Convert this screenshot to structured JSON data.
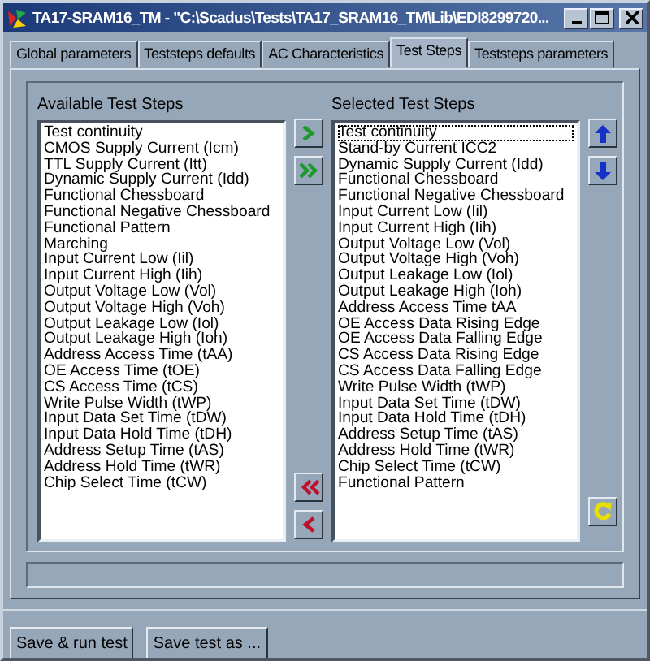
{
  "window": {
    "title": "TA17-SRAM16_TM - \"C:\\Scadus\\Tests\\TA17_SRAM16_TM\\Lib\\EDI8299720..."
  },
  "tabs": [
    {
      "label": "Global parameters",
      "selected": false
    },
    {
      "label": "Teststeps defaults",
      "selected": false
    },
    {
      "label": "AC Characteristics",
      "selected": false
    },
    {
      "label": "Test Steps",
      "selected": true
    },
    {
      "label": "Teststeps parameters",
      "selected": false
    }
  ],
  "available": {
    "label": "Available Test Steps",
    "items": [
      {
        "text": "Test continuity",
        "selected": false
      },
      {
        "text": "CMOS Supply Current (Icm)",
        "selected": false
      },
      {
        "text": "TTL Supply Current (Itt)",
        "selected": false
      },
      {
        "text": "Dynamic Supply Current (Idd)",
        "selected": false
      },
      {
        "text": "Functional Chessboard",
        "selected": false
      },
      {
        "text": "Functional Negative Chessboard",
        "selected": false
      },
      {
        "text": "Functional Pattern",
        "selected": false
      },
      {
        "text": "Marching",
        "selected": false
      },
      {
        "text": "Input Current Low (Iil)",
        "selected": false
      },
      {
        "text": "Input Current High (Iih)",
        "selected": false
      },
      {
        "text": "Output Voltage Low (Vol)",
        "selected": false
      },
      {
        "text": "Output Voltage High (Voh)",
        "selected": false
      },
      {
        "text": "Output Leakage Low (Iol)",
        "selected": false
      },
      {
        "text": "Output Leakage High (Ioh)",
        "selected": false
      },
      {
        "text": "Address Access Time (tAA)",
        "selected": false
      },
      {
        "text": "OE Access Time (tOE)",
        "selected": false
      },
      {
        "text": "CS Access Time (tCS)",
        "selected": false
      },
      {
        "text": "Write Pulse Width (tWP)",
        "selected": false
      },
      {
        "text": "Input Data Set Time (tDW)",
        "selected": false
      },
      {
        "text": "Input Data Hold Time (tDH)",
        "selected": false
      },
      {
        "text": "Address Setup Time (tAS)",
        "selected": false
      },
      {
        "text": "Address Hold Time (tWR)",
        "selected": false
      },
      {
        "text": "Chip Select Time (tCW)",
        "selected": false
      }
    ]
  },
  "selected_steps": {
    "label": "Selected Test Steps",
    "items": [
      {
        "text": "Test continuity",
        "selected": true
      },
      {
        "text": "Stand-by Current ICC2",
        "selected": false
      },
      {
        "text": "Dynamic Supply Current (Idd)",
        "selected": false
      },
      {
        "text": "Functional Chessboard",
        "selected": false
      },
      {
        "text": "Functional Negative Chessboard",
        "selected": false
      },
      {
        "text": "Input Current Low (Iil)",
        "selected": false
      },
      {
        "text": "Input Current High (Iih)",
        "selected": false
      },
      {
        "text": "Output Voltage Low (Vol)",
        "selected": false
      },
      {
        "text": "Output Voltage High (Voh)",
        "selected": false
      },
      {
        "text": "Output Leakage Low (Iol)",
        "selected": false
      },
      {
        "text": "Output Leakage High (Ioh)",
        "selected": false
      },
      {
        "text": "Address Access Time tAA",
        "selected": false
      },
      {
        "text": "OE Access Data Rising Edge",
        "selected": false
      },
      {
        "text": "OE Access Data Falling Edge",
        "selected": false
      },
      {
        "text": "CS Access Data Rising Edge",
        "selected": false
      },
      {
        "text": "CS Access Data Falling Edge",
        "selected": false
      },
      {
        "text": "Write Pulse Width (tWP)",
        "selected": false
      },
      {
        "text": "Input Data Set Time (tDW)",
        "selected": false
      },
      {
        "text": "Input Data Hold Time (tDH)",
        "selected": false
      },
      {
        "text": "Address Setup Time (tAS)",
        "selected": false
      },
      {
        "text": "Address Hold Time (tWR)",
        "selected": false
      },
      {
        "text": "Chip Select Time (tCW)",
        "selected": false
      },
      {
        "text": "Functional Pattern",
        "selected": false
      }
    ]
  },
  "buttons": [
    "Save & run test",
    "Save test as ..."
  ]
}
